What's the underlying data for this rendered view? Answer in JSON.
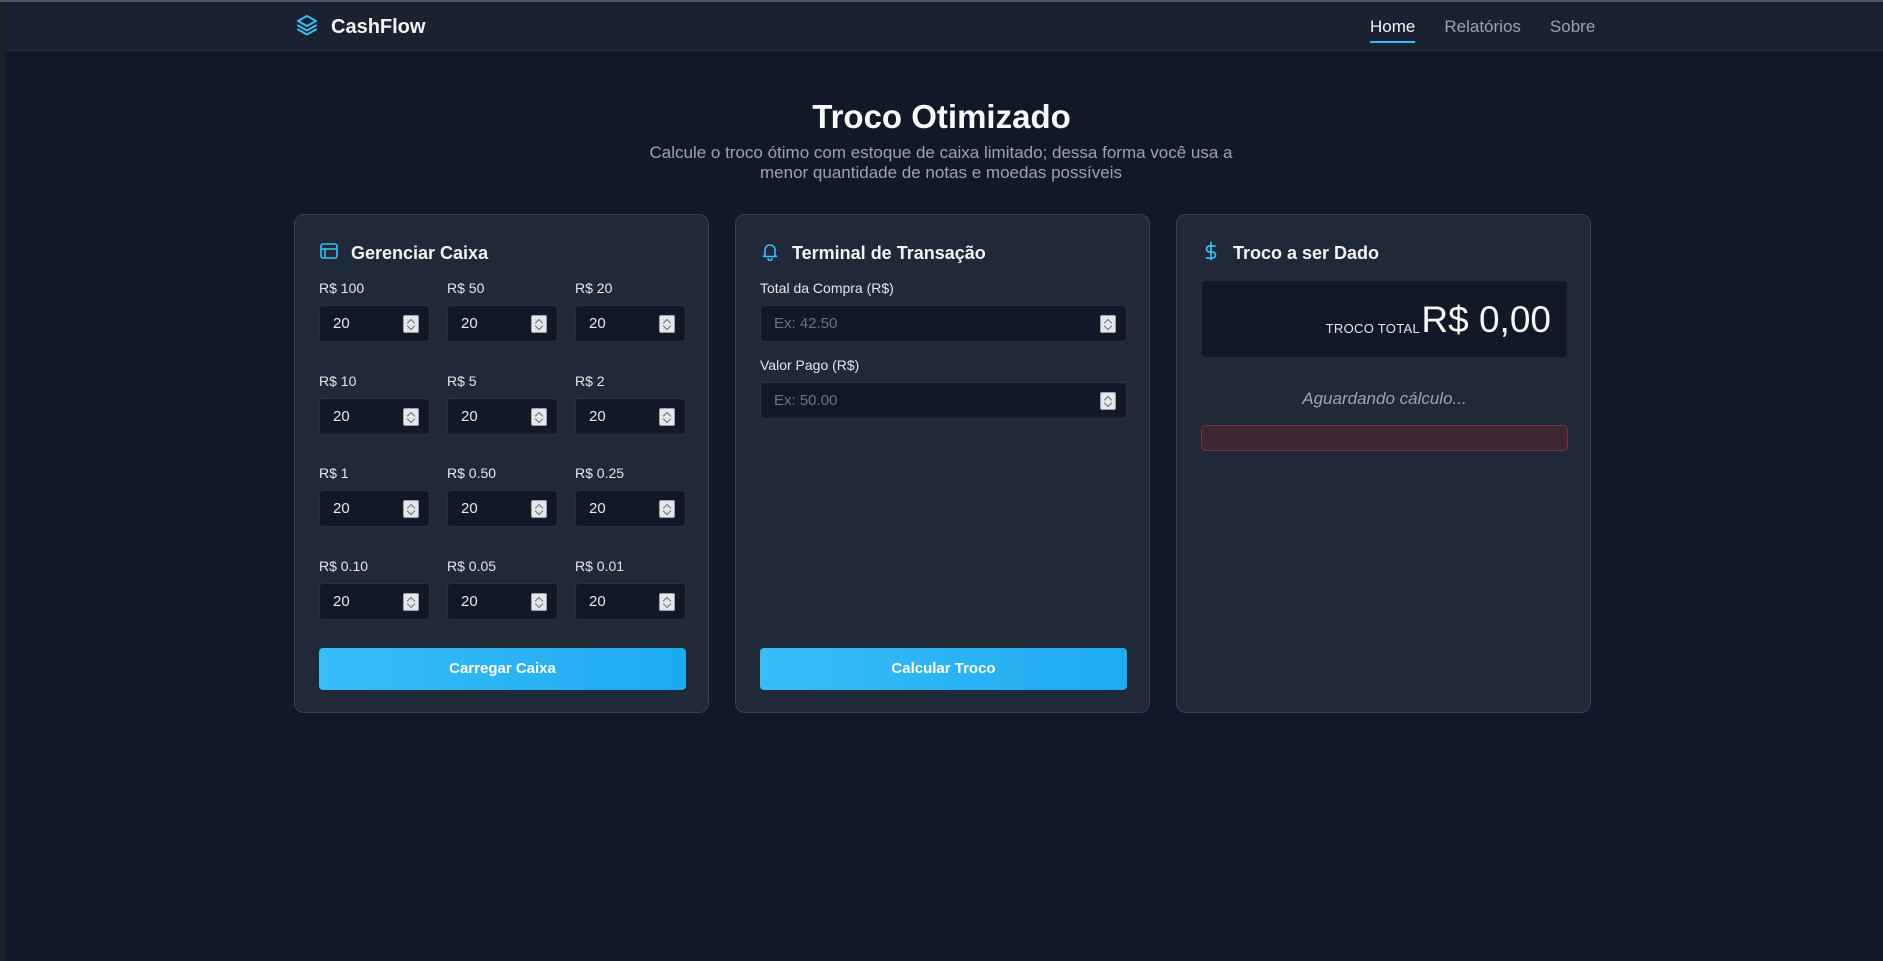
{
  "header": {
    "brand": "CashFlow",
    "nav": [
      "Home",
      "Relatórios",
      "Sobre"
    ],
    "active_nav": "Home"
  },
  "hero": {
    "title": "Troco Otimizado",
    "subtitle": "Calcule o troco ótimo com estoque de caixa limitado; dessa forma você usa a menor quantidade de notas e moedas possíveis"
  },
  "caixa": {
    "title": "Gerenciar Caixa",
    "icon": "wallet-icon",
    "denominations": [
      {
        "label": "R$ 100",
        "value": "20"
      },
      {
        "label": "R$ 50",
        "value": "20"
      },
      {
        "label": "R$ 20",
        "value": "20"
      },
      {
        "label": "R$ 10",
        "value": "20"
      },
      {
        "label": "R$ 5",
        "value": "20"
      },
      {
        "label": "R$ 2",
        "value": "20"
      },
      {
        "label": "R$ 1",
        "value": "20"
      },
      {
        "label": "R$ 0.50",
        "value": "20"
      },
      {
        "label": "R$ 0.25",
        "value": "20"
      },
      {
        "label": "R$ 0.10",
        "value": "20"
      },
      {
        "label": "R$ 0.05",
        "value": "20"
      },
      {
        "label": "R$ 0.01",
        "value": "20"
      }
    ],
    "button": "Carregar Caixa"
  },
  "terminal": {
    "title": "Terminal de Transação",
    "icon": "bell-icon",
    "total_label": "Total da Compra (R$)",
    "total_placeholder": "Ex: 42.50",
    "paid_label": "Valor Pago (R$)",
    "paid_placeholder": "Ex: 50.00",
    "button": "Calcular Troco"
  },
  "troco": {
    "title": "Troco a ser Dado",
    "icon": "dollar-icon",
    "total_label": "TROCO TOTAL",
    "total_value": "R$ 0,00",
    "status": "Aguardando cálculo..."
  },
  "colors": {
    "background": "#111827",
    "card": "#1f2937",
    "accent": "#38bdf8",
    "error_border": "#7f2d3c"
  }
}
